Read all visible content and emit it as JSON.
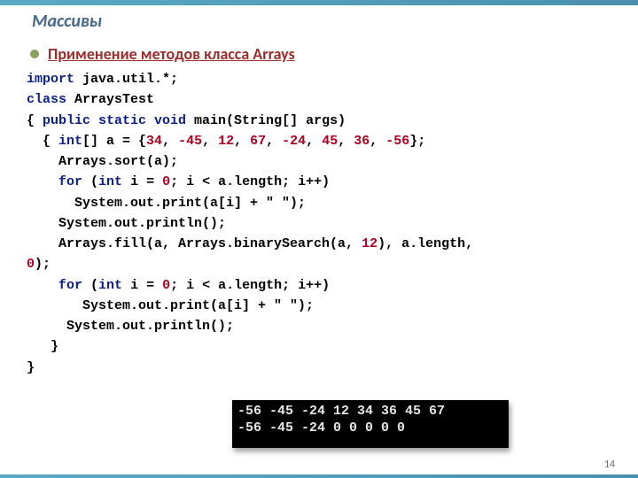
{
  "title": "Массивы",
  "subheading": "Применение методов класса Arrays",
  "code": {
    "l1": {
      "kw": "import",
      "rest": " java.util.*;"
    },
    "l2": {
      "kw": "class",
      "rest": " ArraysTest"
    },
    "l3a": "{ ",
    "l3b": "public static void",
    "l3c": " main(String[] args)",
    "l4a": "  { ",
    "l4b": "int",
    "l4c": "[] a = {",
    "nums": [
      "34",
      "-45",
      "12",
      "67",
      "-24",
      "45",
      "36",
      "-56"
    ],
    "l4end": "};",
    "l5": "    Arrays.sort(a);",
    "l6a": "    ",
    "l6b": "for",
    "l6c": " (",
    "l6d": "int",
    "l6e": " i = ",
    "l6f": "0",
    "l6g": "; i < a.length; i++)",
    "l7": "      System.out.print(a[i] + \" \");",
    "l8": "    System.out.println();",
    "l9a": "    Arrays.fill(a, Arrays.binarySearch(a, ",
    "l9b": "12",
    "l9c": "), a.length,",
    "l10a": "",
    "l10b": "0",
    "l10c": ");",
    "l11a": "    ",
    "l11b": "for",
    "l11c": " (",
    "l11d": "int",
    "l11e": " i = ",
    "l11f": "0",
    "l11g": "; i < a.length; i++)",
    "l12": "       System.out.print(a[i] + \" \");",
    "l13": "     System.out.println();",
    "l14": "   }",
    "l15": "}"
  },
  "console": {
    "line1": "-56 -45 -24 12 34 36 45 67",
    "line2": "-56 -45 -24 0 0 0 0 0"
  },
  "page_number": "14"
}
